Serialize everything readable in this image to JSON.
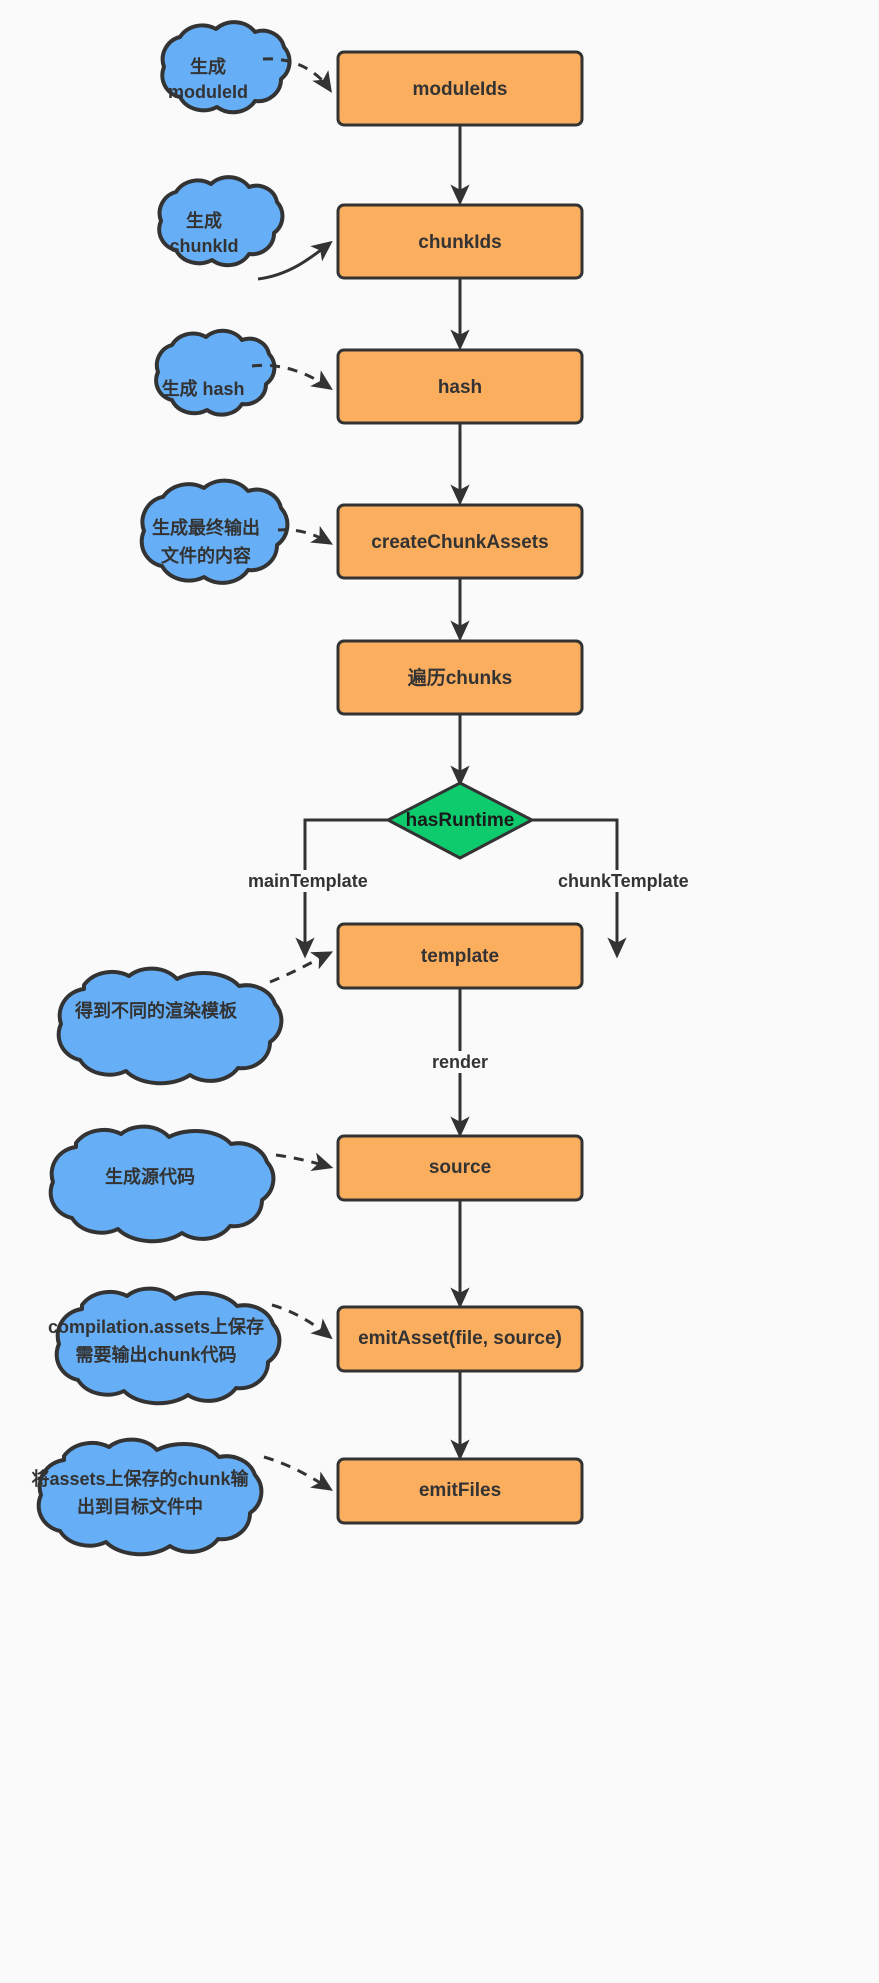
{
  "diagram": {
    "title": "webpack createChunkAssets flow",
    "background_color": "#fafafa",
    "process_fill": "#FCAE5F",
    "decision_fill": "#0ECB6E",
    "note_fill": "#66AFF6",
    "stroke_color": "#333333"
  },
  "nodes": [
    {
      "id": "moduleIds",
      "label": "moduleIds",
      "type": "process"
    },
    {
      "id": "chunkIds",
      "label": "chunkIds",
      "type": "process"
    },
    {
      "id": "hash",
      "label": "hash",
      "type": "process"
    },
    {
      "id": "createChunkAssets",
      "label": "createChunkAssets",
      "type": "process"
    },
    {
      "id": "traverse",
      "label": "遍历chunks",
      "type": "process"
    },
    {
      "id": "hasRuntime",
      "label": "hasRuntime",
      "type": "decision"
    },
    {
      "id": "template",
      "label": "template",
      "type": "process"
    },
    {
      "id": "source",
      "label": "source",
      "type": "process"
    },
    {
      "id": "emitAsset",
      "label": "emitAsset(file, source)",
      "type": "process"
    },
    {
      "id": "emitFiles",
      "label": "emitFiles",
      "type": "process"
    }
  ],
  "notes": [
    {
      "id": "note-moduleid",
      "lines": [
        "生成",
        "moduleId"
      ],
      "link": "dashed",
      "target": "moduleIds"
    },
    {
      "id": "note-chunkid",
      "lines": [
        "生成",
        "chunkId"
      ],
      "link": "solid",
      "target": "chunkIds"
    },
    {
      "id": "note-hash",
      "lines": [
        "生成 hash"
      ],
      "link": "dashed",
      "target": "hash"
    },
    {
      "id": "note-output",
      "lines": [
        "生成最终输出",
        "文件的内容"
      ],
      "link": "dashed",
      "target": "createChunkAssets"
    },
    {
      "id": "note-template",
      "lines": [
        "得到不同的渲染模板"
      ],
      "link": "dashed",
      "target": "template"
    },
    {
      "id": "note-source",
      "lines": [
        "生成源代码"
      ],
      "link": "dashed",
      "target": "source"
    },
    {
      "id": "note-emitasset",
      "lines": [
        "compilation.assets上保存",
        "需要输出chunk代码"
      ],
      "link": "dashed",
      "target": "emitAsset"
    },
    {
      "id": "note-emitfiles",
      "lines": [
        "将assets上保存的chunk输",
        "出到目标文件中"
      ],
      "link": "dashed",
      "target": "emitFiles"
    }
  ],
  "edge_labels": [
    {
      "id": "label-main-template",
      "text": "mainTemplate"
    },
    {
      "id": "label-chunk-template",
      "text": "chunkTemplate"
    },
    {
      "id": "label-render",
      "text": "render"
    }
  ]
}
